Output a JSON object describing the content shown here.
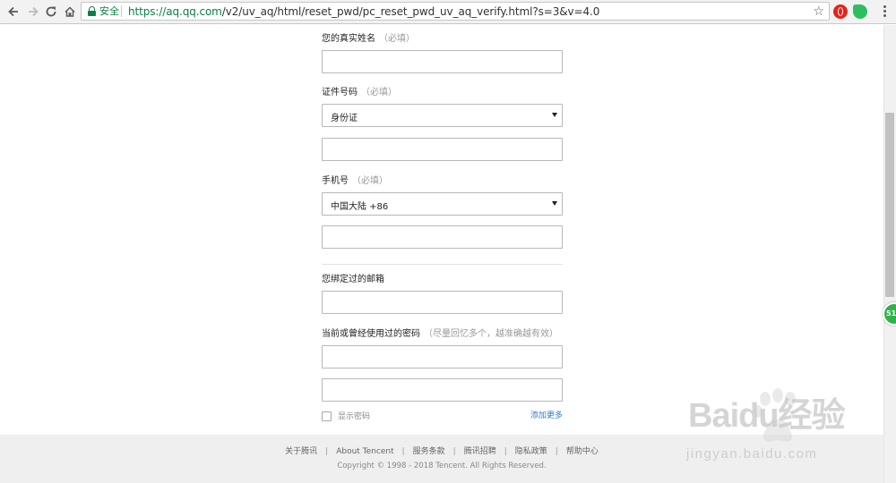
{
  "browser": {
    "back_icon": "arrow-left-icon",
    "forward_icon": "arrow-right-icon",
    "reload_icon": "reload-icon",
    "home_icon": "home-icon",
    "secure_label": "安全",
    "url_host": "https://aq.qq.com",
    "url_path": "/v2/uv_aq/html/reset_pwd/pc_reset_pwd_uv_aq_verify.html?s=3&v=4.0",
    "secure_color": "#0b8043"
  },
  "form": {
    "name_label": "您的真实姓名",
    "name_hint": "（必填）",
    "name_value": "",
    "id_label": "证件号码",
    "id_hint": "（必填）",
    "id_type_selected": "身份证",
    "id_value": "",
    "phone_label": "手机号",
    "phone_hint": "（必填）",
    "phone_region_selected": "中国大陆 +86",
    "phone_value": "",
    "email_label": "您绑定过的邮箱",
    "email_value": "",
    "password_label": "当前或曾经使用过的密码",
    "password_hint": "（尽量回忆多个，越准确越有效）",
    "password1_value": "",
    "password2_value": "",
    "show_password_label": "显示密码",
    "add_more_label": "添加更多",
    "link_color": "#2d7dd2"
  },
  "footer": {
    "links": [
      "关于腾讯",
      "About Tencent",
      "服务条款",
      "腾讯招聘",
      "隐私政策",
      "帮助中心"
    ],
    "separator": "|",
    "copyright": "Copyright © 1998 - 2018 Tencent. All Rights Reserved."
  },
  "badge": {
    "text": "51",
    "color": "#2fb24a"
  },
  "watermark": {
    "brand": "Baidu经验",
    "sub": "jingyan.baidu.com"
  }
}
